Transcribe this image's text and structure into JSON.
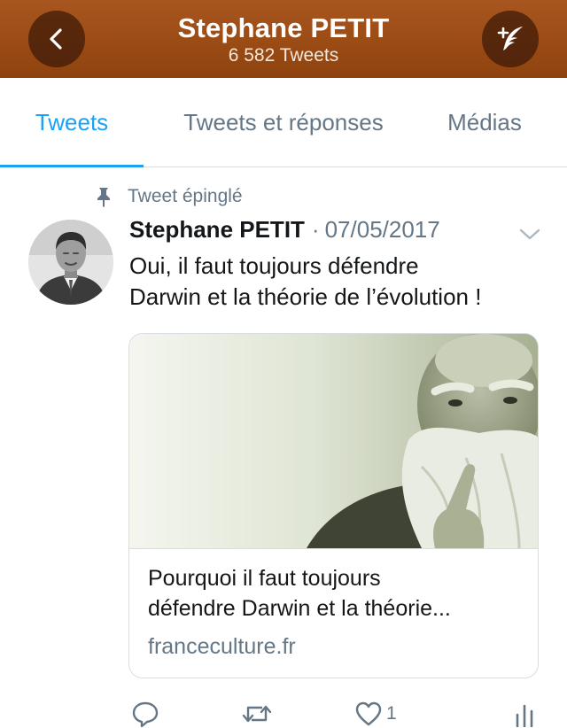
{
  "header": {
    "title": "Stephane PETIT",
    "subtitle": "6 582 Tweets",
    "color": "#9b4b14",
    "back_icon": "chevron-left-icon",
    "compose_icon": "compose-tweet-icon"
  },
  "tabs": [
    {
      "label": "Tweets",
      "active": true
    },
    {
      "label": "Tweets et réponses",
      "active": false
    },
    {
      "label": "Médias",
      "active": false
    }
  ],
  "accent_color": "#1da1f2",
  "tweet": {
    "pinned_label": "Tweet épinglé",
    "author": "Stephane PETIT",
    "separator": "·",
    "date": "07/05/2017",
    "text_line1": "Oui, il faut toujours défendre",
    "text_line2": "Darwin et la théorie de l’évolution !",
    "card": {
      "title_line1": "Pourquoi il faut toujours",
      "title_line2": "défendre Darwin et la théorie...",
      "domain": "franceculture.fr"
    },
    "actions": {
      "reply_icon": "reply-icon",
      "retweet_icon": "retweet-icon",
      "like_icon": "heart-icon",
      "like_count": "1",
      "analytics_icon": "analytics-icon"
    }
  }
}
